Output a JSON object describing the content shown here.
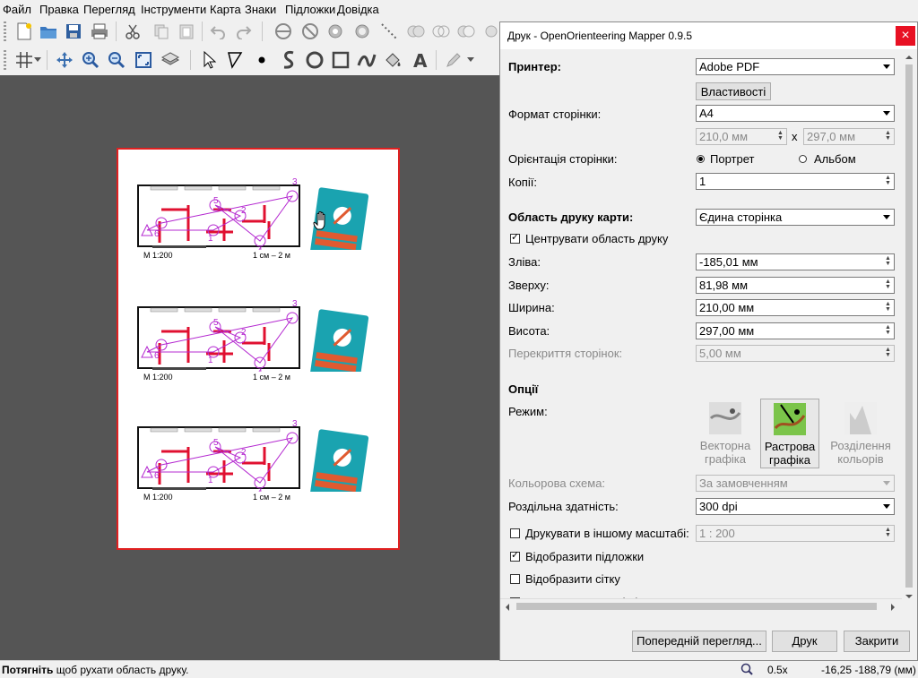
{
  "menu": [
    "Файл",
    "Правка",
    "Перегляд",
    "Інструменти",
    "Карта",
    "Знаки",
    "Підложки",
    "Довідка"
  ],
  "map": {
    "scale_label": "М 1:200",
    "scale_right": "1 см – 2 м",
    "control_numbers": [
      "1",
      "2",
      "3",
      "4",
      "5",
      "6"
    ]
  },
  "status": {
    "action": "Потягніть",
    "message": " щоб рухати область друку.",
    "zoom": "0.5x",
    "coords": "-16,25 -188,79 (мм)"
  },
  "dialog": {
    "title": "Друк - OpenOrienteering Mapper 0.9.5",
    "close_icon": "×",
    "printer_label": "Принтер:",
    "printer_value": "Adobe PDF",
    "properties_button": "Властивості",
    "page_format_label": "Формат сторінки:",
    "page_format_value": "A4",
    "page_width": "210,0 мм",
    "page_height": "297,0 мм",
    "times": "x",
    "orientation_label": "Орієнтація сторінки:",
    "portrait": "Портрет",
    "landscape": "Альбом",
    "copies_label": "Копії:",
    "copies_value": "1",
    "area_label": "Область друку карти:",
    "area_value": "Єдина сторінка",
    "center_area": "Центрувати область друку",
    "left_label": "Зліва:",
    "left_value": "-185,01 мм",
    "top_label": "Зверху:",
    "top_value": "81,98 мм",
    "width_label": "Ширина:",
    "width_value": "210,00 мм",
    "height_label": "Висота:",
    "height_value": "297,00 мм",
    "overlap_label": "Перекриття сторінок:",
    "overlap_value": "5,00 мм",
    "options_label": "Опції",
    "mode_label": "Режим:",
    "mode_vector_1": "Векторна",
    "mode_vector_2": "графіка",
    "mode_raster_1": "Растрова",
    "mode_raster_2": "графіка",
    "mode_sep_1": "Розділення",
    "mode_sep_2": "кольорів",
    "color_scheme_label": "Кольорова схема:",
    "color_scheme_value": "За замовченням",
    "resolution_label": "Роздільна здатність:",
    "resolution_value": "300 dpi",
    "other_scale": "Друкувати в іншому масштабі:",
    "other_scale_value": "1 : 200",
    "show_templates": "Відобразити підложки",
    "show_grid": "Відобразити сітку",
    "simulate_overprinting": "Емулювати overprinting",
    "preview_button": "Попередній перегляд...",
    "print_button": "Друк",
    "close_button": "Закрити"
  },
  "colors": {
    "page_border": "#e02020",
    "map_background": "#555555",
    "course_purple": "#b428d0",
    "wall_red": "#e01030",
    "card_teal": "#1aa3b0",
    "close_red": "#e81123"
  }
}
